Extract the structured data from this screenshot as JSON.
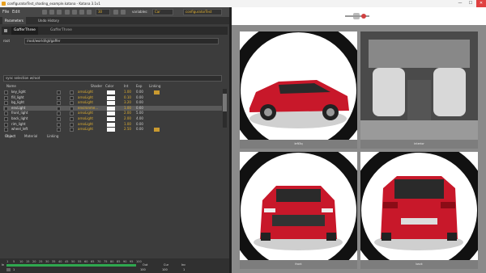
{
  "window": {
    "title": "configuratorTest_shading_example.katana - Katana 3.1v1",
    "btn_min": "—",
    "btn_max": "☐",
    "btn_close": "✕"
  },
  "menubar": {
    "items": [
      "File",
      "Edit"
    ],
    "frame_value": "30",
    "variables_label": "variables:",
    "variables_value": "Car",
    "configurator_value": "configuratorTest"
  },
  "panel_tabs": [
    "Parameters",
    "Undo History"
  ],
  "node": {
    "name": "GafferThree",
    "type": "GafferThree"
  },
  "path": {
    "label": "root",
    "value": "/root/world/lgt/gaffer"
  },
  "sync": {
    "value": "sync selection w/root"
  },
  "table": {
    "headers": [
      "Name",
      "",
      "Shader",
      "Color",
      "Int",
      "Exp",
      "Linking"
    ],
    "rows": [
      {
        "name": "key_light",
        "shader": "arnoLight",
        "int": "1.00",
        "exp": "0.00",
        "linked": true,
        "selected": false
      },
      {
        "name": "fill_light",
        "shader": "arnoLight",
        "int": "0.10",
        "exp": "0.00",
        "linked": false,
        "selected": false
      },
      {
        "name": "bg_light",
        "shader": "arnoLight",
        "int": "3.20",
        "exp": "0.00",
        "linked": false,
        "selected": false
      },
      {
        "name": "envLight",
        "shader": "environme...",
        "int": "1.00",
        "exp": "0.60",
        "linked": false,
        "selected": true
      },
      {
        "name": "front_light",
        "shader": "arnoLight",
        "int": "2.00",
        "exp": "5.00",
        "linked": false,
        "selected": false
      },
      {
        "name": "back_light",
        "shader": "arnoLight",
        "int": "2.00",
        "exp": "4.00",
        "linked": false,
        "selected": false
      },
      {
        "name": "rim_light",
        "shader": "arnoLight",
        "int": "1.00",
        "exp": "0.00",
        "linked": false,
        "selected": false
      },
      {
        "name": "wheel_left",
        "shader": "arnoLight",
        "int": "2.50",
        "exp": "0.00",
        "linked": true,
        "selected": false
      }
    ]
  },
  "subtabs": [
    "Object",
    "Material",
    "Linking"
  ],
  "timeline": {
    "ticks": [
      "1",
      "5",
      "10",
      "15",
      "20",
      "25",
      "30",
      "35",
      "40",
      "45",
      "50",
      "55",
      "60",
      "65",
      "70",
      "75",
      "80",
      "85",
      "90",
      "95",
      "100"
    ],
    "progress": 1.0,
    "in_label": "In",
    "in_value": "1",
    "out_label": "Out",
    "out_value": "100",
    "cur_label": "Cur",
    "cur_value": "100",
    "inc_label": "Inc",
    "inc_value": "1",
    "colors": {
      "progress": "#2fa84f"
    }
  },
  "viewer": {
    "cells": [
      {
        "caption": "left3q"
      },
      {
        "caption": "interior"
      },
      {
        "caption": "front"
      },
      {
        "caption": "back"
      }
    ]
  }
}
